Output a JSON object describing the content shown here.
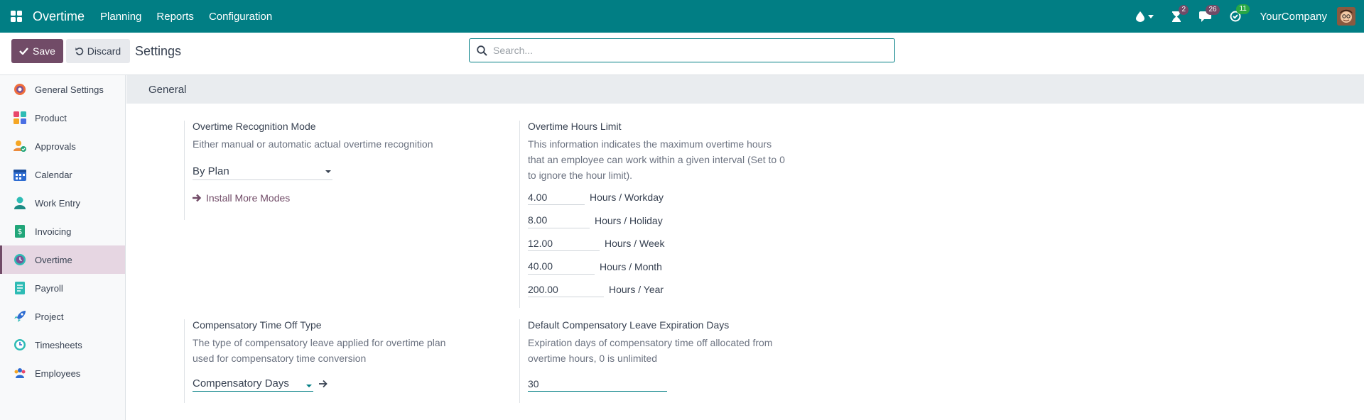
{
  "navbar": {
    "app_title": "Overtime",
    "menu": [
      "Planning",
      "Reports",
      "Configuration"
    ],
    "activity_badge": "2",
    "messages_badge": "26",
    "todo_badge": "11",
    "company": "YourCompany",
    "colors": {
      "bar": "#017e84",
      "badge_purple": "#714b67",
      "badge_green": "#28a745"
    }
  },
  "control_panel": {
    "save_label": "Save",
    "discard_label": "Discard",
    "title": "Settings",
    "search_placeholder": "Search..."
  },
  "sidebar": {
    "items": [
      {
        "label": "General Settings",
        "icon": "general-settings-icon"
      },
      {
        "label": "Product",
        "icon": "product-icon"
      },
      {
        "label": "Approvals",
        "icon": "approvals-icon"
      },
      {
        "label": "Calendar",
        "icon": "calendar-icon"
      },
      {
        "label": "Work Entry",
        "icon": "work-entry-icon"
      },
      {
        "label": "Invoicing",
        "icon": "invoicing-icon"
      },
      {
        "label": "Overtime",
        "icon": "overtime-icon",
        "active": true
      },
      {
        "label": "Payroll",
        "icon": "payroll-icon"
      },
      {
        "label": "Project",
        "icon": "project-icon"
      },
      {
        "label": "Timesheets",
        "icon": "timesheets-icon"
      },
      {
        "label": "Employees",
        "icon": "employees-icon"
      }
    ]
  },
  "main": {
    "section_title": "General",
    "recognition": {
      "title": "Overtime Recognition Mode",
      "description": "Either manual or automatic actual overtime recognition",
      "value": "By Plan",
      "install_link": "Install More Modes"
    },
    "hours_limit": {
      "title": "Overtime Hours Limit",
      "description_lines": [
        "This information indicates the maximum overtime hours",
        "that an employee can work within a given interval (Set to 0",
        "to ignore the hour limit)."
      ],
      "rows": [
        {
          "value": "4.00",
          "unit": "Hours / Workday"
        },
        {
          "value": "8.00",
          "unit": "Hours / Holiday"
        },
        {
          "value": "12.00",
          "unit": "Hours / Week"
        },
        {
          "value": "40.00",
          "unit": "Hours / Month"
        },
        {
          "value": "200.00",
          "unit": "Hours / Year"
        }
      ]
    },
    "comp_type": {
      "title": "Compensatory Time Off Type",
      "description_lines": [
        "The type of compensatory leave applied for overtime plan",
        "used for compensatory time conversion"
      ],
      "value": "Compensatory Days"
    },
    "expiration": {
      "title": "Default Compensatory Leave Expiration Days",
      "description_lines": [
        "Expiration days of compensatory time off allocated from",
        "overtime hours, 0 is unlimited"
      ],
      "value": "30"
    }
  }
}
